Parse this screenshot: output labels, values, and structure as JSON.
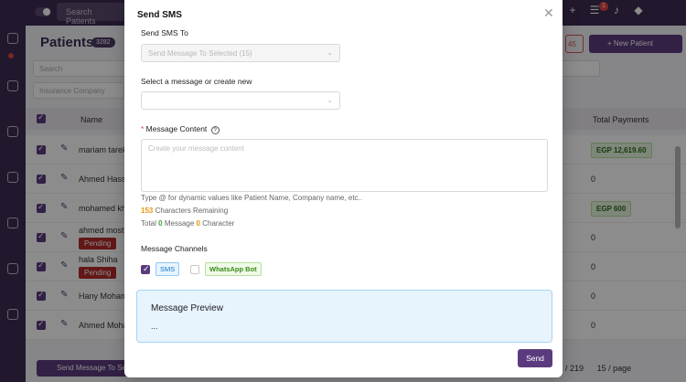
{
  "topbar": {
    "search_placeholder": "Search Patients",
    "notification_count": "1"
  },
  "page": {
    "title": "Patients",
    "count": "3282",
    "new_patient_label": "+ New Patient",
    "red_stub": "45",
    "search_placeholder": "Search",
    "insurance_placeholder": "Insurance Company"
  },
  "table": {
    "columns": {
      "name": "Name",
      "total_payments": "Total Payments"
    },
    "rows": [
      {
        "name": "mariam tarek",
        "payment_badge": "EGP 12,619.60"
      },
      {
        "name": "Ahmed Hassan",
        "payment": "0"
      },
      {
        "name": "mohamed kh",
        "payment_badge": "EGP 600"
      },
      {
        "name": "ahmed mosta",
        "status": "Pending",
        "payment": "0"
      },
      {
        "name": "hala Shiha",
        "status": "Pending",
        "payment": "0"
      },
      {
        "name": "Hany Moham",
        "payment": "0"
      },
      {
        "name": "Ahmed Moha",
        "payment": "0"
      }
    ]
  },
  "footer": {
    "send_selected_label": "Send Message To Se",
    "page_total": "219",
    "page_size": "15 / page"
  },
  "modal": {
    "title": "Send SMS",
    "send_to_label": "Send SMS To",
    "send_to_value": "Send Message To Selected (15)",
    "select_message_label": "Select a message or create new",
    "message_content_label": "Message Content",
    "message_placeholder": "Create your message content",
    "hint_dynamic": "Type @ for dynamic values like Patient Name, Company name, etc..",
    "chars_remaining_count": "153",
    "chars_remaining_text": "Characters Remaining",
    "total_prefix": "Total",
    "total_message_count": "0",
    "total_message_word": "Message",
    "total_char_count": "0",
    "total_char_word": "Character",
    "channels_label": "Message Channels",
    "channel_sms": "SMS",
    "channel_whatsapp": "WhatsApp Bot",
    "preview_title": "Message Preview",
    "preview_body": "...",
    "send_label": "Send"
  },
  "colors": {
    "primary": "#5b3b7e",
    "preview_bg": "#e7f3fd",
    "sms_tag": "#1677c9",
    "whatsapp_tag": "#3a8a1a"
  }
}
